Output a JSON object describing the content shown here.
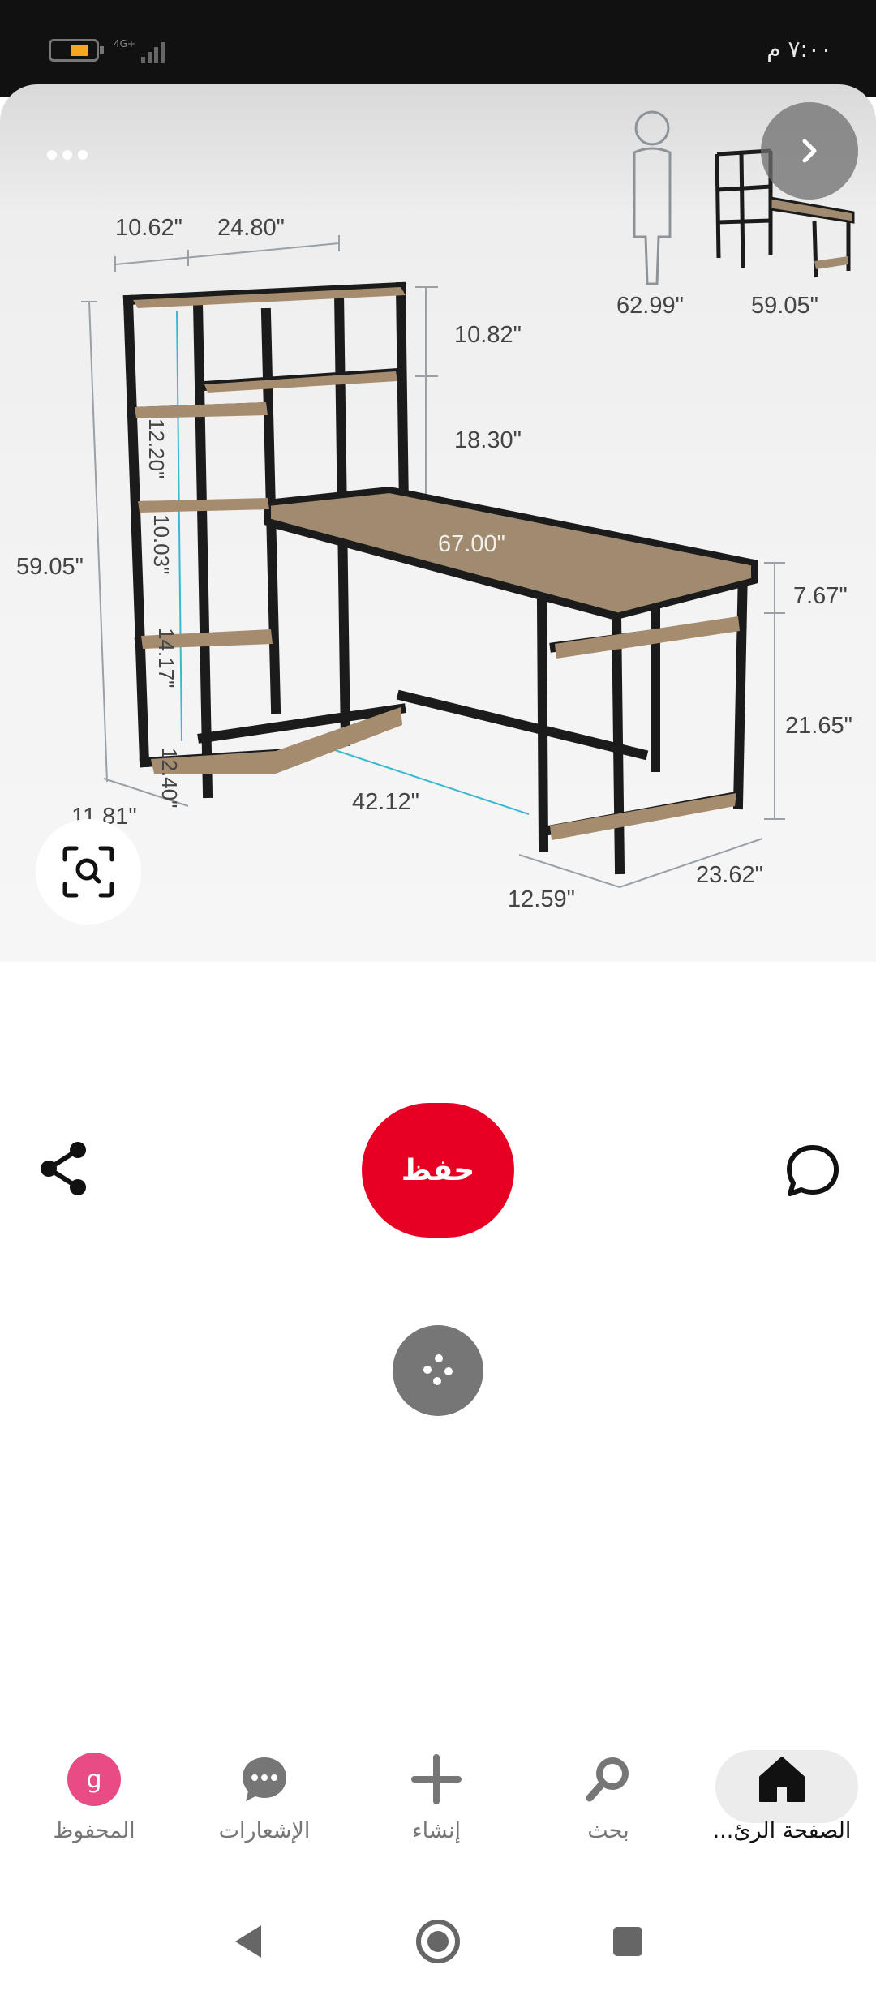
{
  "status_bar": {
    "time": "٧:٠٠ م",
    "network": "4G+"
  },
  "pin": {
    "image_description_icon": "desk-with-shelves-diagram",
    "dimensions": {
      "top_left": "10.62\"",
      "top_right": "24.80\"",
      "shelf_1": "12.20\"",
      "shelf_2": "10.03\"",
      "shelf_3": "14.17\"",
      "shelf_4": "12.40\"",
      "upper_right_1": "10.82\"",
      "upper_right_2": "18.30\"",
      "total_height": "59.05\"",
      "desk_length": "67.00\"",
      "right_upper": "7.67\"",
      "right_lower": "21.65\"",
      "depth_left": "11.81\"",
      "desk_depth": "42.12\"",
      "bottom_right_1": "12.59\"",
      "bottom_right_2": "23.62\"",
      "person_height": "62.99\"",
      "thumb_height": "59.05\""
    }
  },
  "actions": {
    "save_label": "حفظ"
  },
  "bottom_nav": {
    "items": [
      {
        "label": "المحفوظ",
        "icon": "profile-avatar",
        "avatar_letter": "g"
      },
      {
        "label": "الإشعارات",
        "icon": "chat-bubble-icon"
      },
      {
        "label": "إنشاء",
        "icon": "plus-icon"
      },
      {
        "label": "بحث",
        "icon": "search-icon"
      },
      {
        "label": "الصفحة الرئ...",
        "icon": "home-icon"
      }
    ]
  },
  "colors": {
    "save_red": "#e60023",
    "avatar_pink": "#e94b84",
    "status_bar_bg": "#111111"
  }
}
